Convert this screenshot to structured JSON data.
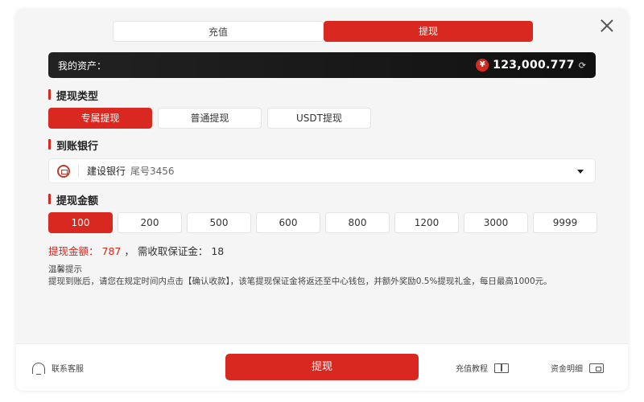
{
  "tabs": [
    {
      "label": "充值",
      "active": false
    },
    {
      "label": "提现",
      "active": true
    }
  ],
  "assets": {
    "label": "我的资产：",
    "currency_symbol": "¥",
    "amount": "123,000.777"
  },
  "withdraw_type": {
    "title": "提现类型",
    "options": [
      "专属提现",
      "普通提现",
      "USDT提现"
    ],
    "selected": 0
  },
  "bank": {
    "title": "到账银行",
    "name": "建设银行",
    "tail": "尾号3456"
  },
  "withdraw_amount": {
    "title": "提现金额",
    "options": [
      "100",
      "200",
      "500",
      "600",
      "800",
      "1200",
      "3000",
      "9999"
    ],
    "selected": 0
  },
  "summary": {
    "amount_label": "提现金额：",
    "amount_value": "787",
    "separator": "，",
    "deposit_label": "需收取保证金：",
    "deposit_value": "18"
  },
  "tips": {
    "title": "温馨提示",
    "text": "提现到账后，请您在规定时间内点击【确认收款】，该笔提现保证金将返还至中心钱包，并额外奖励0.5%提现礼金，每日最高1000元。"
  },
  "footer": {
    "service_label": "联系客服",
    "submit_label": "提现",
    "tutorial_label": "充值教程",
    "details_label": "资金明细"
  },
  "colors": {
    "accent": "#d8281f",
    "asset_bar": "#111111"
  }
}
